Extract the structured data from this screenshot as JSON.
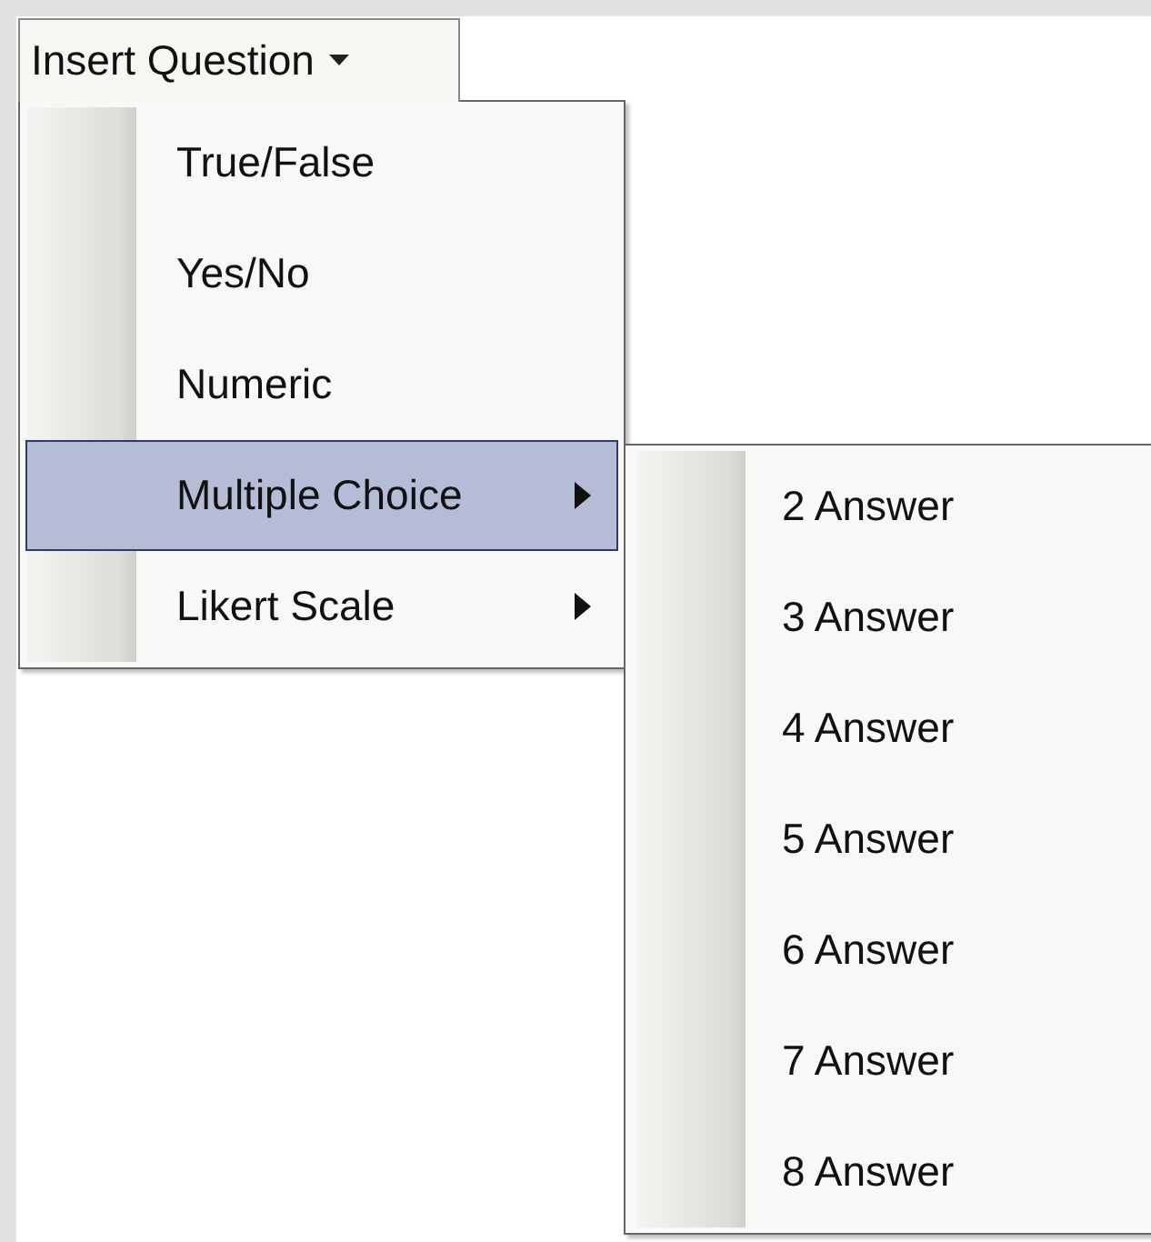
{
  "menu_button": {
    "label": "Insert Question",
    "expanded": true
  },
  "menu": {
    "items": [
      {
        "label": "True/False",
        "selected": false,
        "has_submenu": false
      },
      {
        "label": "Yes/No",
        "selected": false,
        "has_submenu": false
      },
      {
        "label": "Numeric",
        "selected": false,
        "has_submenu": false
      },
      {
        "label": "Multiple Choice",
        "selected": true,
        "has_submenu": true,
        "submenu": [
          {
            "label": "2 Answer"
          },
          {
            "label": "3 Answer"
          },
          {
            "label": "4 Answer"
          },
          {
            "label": "5 Answer"
          },
          {
            "label": "6 Answer"
          },
          {
            "label": "7 Answer"
          },
          {
            "label": "8 Answer"
          }
        ]
      },
      {
        "label": "Likert Scale",
        "selected": false,
        "has_submenu": true
      }
    ]
  }
}
